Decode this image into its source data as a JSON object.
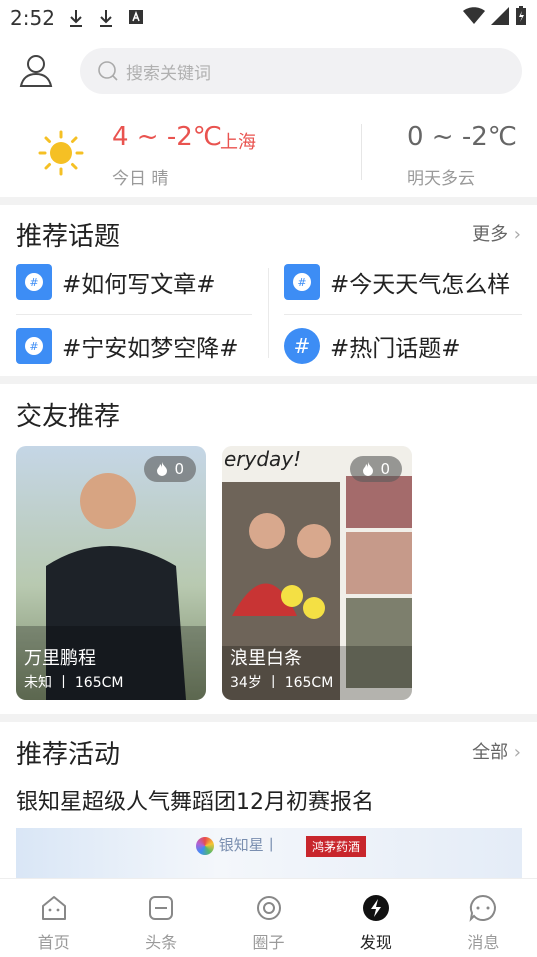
{
  "status_bar": {
    "time": "2:52"
  },
  "search": {
    "placeholder": "搜索关键词"
  },
  "weather": {
    "today_temp": "4 ~ -2℃",
    "city": "上海",
    "today_label": "今日 晴",
    "tomorrow_temp": "0 ~ -2℃",
    "tomorrow_label": "明天多云"
  },
  "topics": {
    "title": "推荐话题",
    "more": "更多",
    "items": [
      {
        "label": "#如何写文章#"
      },
      {
        "label": "#今天天气怎么样"
      },
      {
        "label": "#宁安如梦空降#"
      },
      {
        "label": "#热门话题#"
      }
    ]
  },
  "friends": {
    "title": "交友推荐",
    "cards": [
      {
        "name": "万里鹏程",
        "info": "未知 丨 165CM",
        "hot": "0"
      },
      {
        "name": "浪里白条",
        "info": "34岁 丨 165CM",
        "hot": "0"
      }
    ]
  },
  "activities": {
    "title": "推荐活动",
    "more": "全部",
    "item_title": "银知星超级人气舞蹈团12月初赛报名",
    "banner_brand": "银知星丨",
    "banner_tag": "鸿茅药酒"
  },
  "tabs": [
    {
      "label": "首页"
    },
    {
      "label": "头条"
    },
    {
      "label": "圈子"
    },
    {
      "label": "发现"
    },
    {
      "label": "消息"
    }
  ],
  "colors": {
    "accent_red": "#e9534f",
    "topic_blue": "#3d8df5",
    "sun": "#f5c024"
  }
}
